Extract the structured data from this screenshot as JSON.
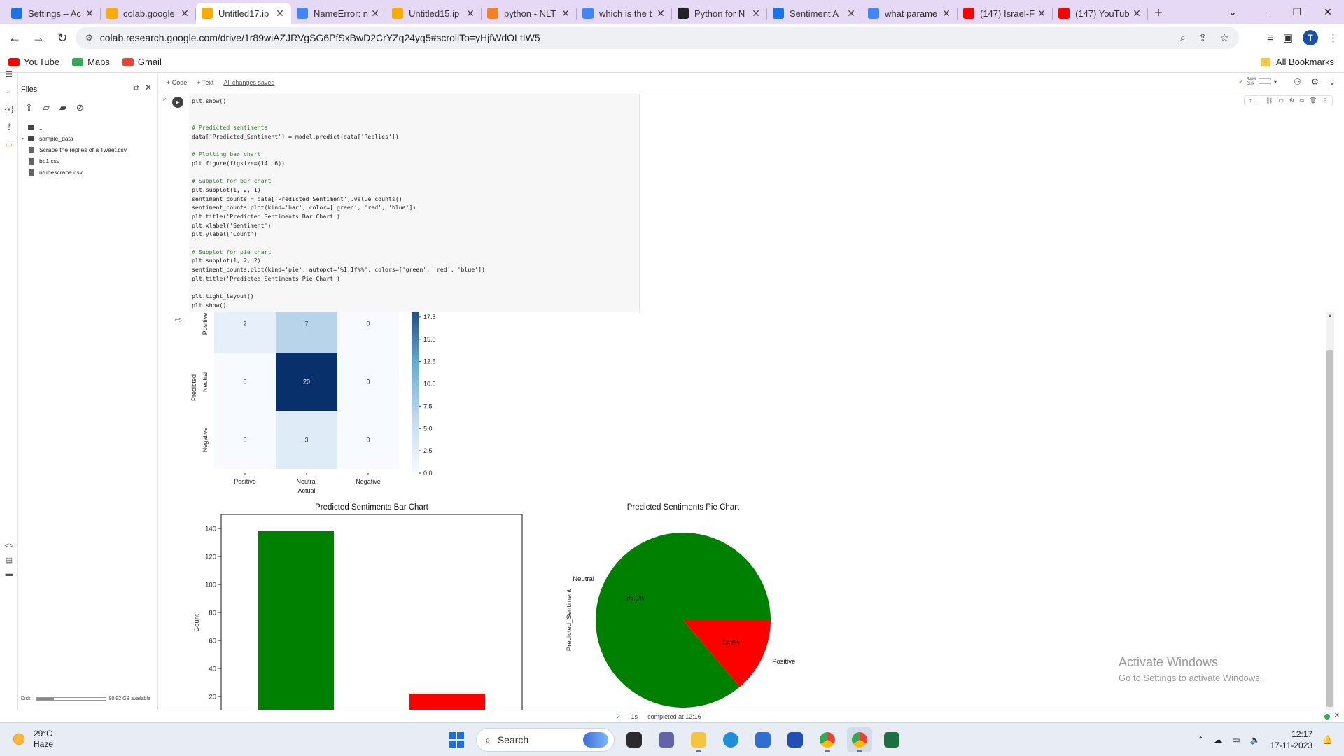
{
  "browser": {
    "tabs": [
      {
        "title": "Settings – Ac",
        "favicon": "gear-icon",
        "color": "#1a73e8"
      },
      {
        "title": "colab.google",
        "favicon": "colab-icon",
        "color": "#f9ab00"
      },
      {
        "title": "Untitled17.ip",
        "favicon": "colab-icon",
        "color": "#f9ab00",
        "active": true
      },
      {
        "title": "NameError: n",
        "favicon": "google-icon",
        "color": "#4285f4"
      },
      {
        "title": "Untitled15.ip",
        "favicon": "colab-icon",
        "color": "#f9ab00"
      },
      {
        "title": "python - NLT",
        "favicon": "stackoverflow-icon",
        "color": "#f48024"
      },
      {
        "title": "which is the t",
        "favicon": "google-icon",
        "color": "#4285f4"
      },
      {
        "title": "Python for N",
        "favicon": "site-icon",
        "color": "#222222"
      },
      {
        "title": "Sentiment A",
        "favicon": "shield-icon",
        "color": "#1a73e8"
      },
      {
        "title": "what parame",
        "favicon": "google-icon",
        "color": "#4285f4"
      },
      {
        "title": "(147) Israel-F",
        "favicon": "youtube-icon",
        "color": "#ff0000"
      },
      {
        "title": "(147) YouTub",
        "favicon": "youtube-icon",
        "color": "#ff0000"
      }
    ],
    "url": "colab.research.google.com/drive/1r89wiAZJRVgSG6PfSxBwD2CrYZq24yq5#scrollTo=yHjfWdOLtIW5",
    "avatar_letter": "T",
    "bookmarks": [
      {
        "label": "YouTube",
        "color": "#ff0000"
      },
      {
        "label": "Maps",
        "color": "#34a853"
      },
      {
        "label": "Gmail",
        "color": "#ea4335"
      }
    ],
    "all_bookmarks": "All Bookmarks"
  },
  "colab": {
    "files_title": "Files",
    "file_tree": [
      {
        "name": "..",
        "type": "dir",
        "expand": false
      },
      {
        "name": "sample_data",
        "type": "dir",
        "expand": true
      },
      {
        "name": "Scrape the replies of a Tweet.csv",
        "type": "file"
      },
      {
        "name": "bb1.csv",
        "type": "file"
      },
      {
        "name": "utubescrape.csv",
        "type": "file"
      }
    ],
    "disk_label": "Disk",
    "disk_fraction": 0.25,
    "disk_available": "80.92 GB available",
    "toolbar": {
      "code": "+ Code",
      "text": "+ Text",
      "saved": "All changes saved",
      "ram": "RAM",
      "disk": "Disk"
    },
    "code_lines": [
      {
        "t": "plt.show()",
        "k": "code"
      },
      {
        "t": "",
        "k": "code"
      },
      {
        "t": "",
        "k": "code"
      },
      {
        "t": "# Predicted sentiments",
        "k": "comment"
      },
      {
        "t": "data['Predicted_Sentiment'] = model.predict(data['Replies'])",
        "k": "code"
      },
      {
        "t": "",
        "k": "code"
      },
      {
        "t": "# Plotting bar chart",
        "k": "comment"
      },
      {
        "t": "plt.figure(figsize=(14, 6))",
        "k": "code"
      },
      {
        "t": "",
        "k": "code"
      },
      {
        "t": "# Subplot for bar chart",
        "k": "comment"
      },
      {
        "t": "plt.subplot(1, 2, 1)",
        "k": "code"
      },
      {
        "t": "sentiment_counts = data['Predicted_Sentiment'].value_counts()",
        "k": "code"
      },
      {
        "t": "sentiment_counts.plot(kind='bar', color=['green', 'red', 'blue'])",
        "k": "code"
      },
      {
        "t": "plt.title('Predicted Sentiments Bar Chart')",
        "k": "code"
      },
      {
        "t": "plt.xlabel('Sentiment')",
        "k": "code"
      },
      {
        "t": "plt.ylabel('Count')",
        "k": "code"
      },
      {
        "t": "",
        "k": "code"
      },
      {
        "t": "# Subplot for pie chart",
        "k": "comment"
      },
      {
        "t": "plt.subplot(1, 2, 2)",
        "k": "code"
      },
      {
        "t": "sentiment_counts.plot(kind='pie', autopct='%1.1f%%', colors=['green', 'red', 'blue'])",
        "k": "code"
      },
      {
        "t": "plt.title('Predicted Sentiments Pie Chart')",
        "k": "code"
      },
      {
        "t": "",
        "k": "code"
      },
      {
        "t": "plt.tight_layout()",
        "k": "code"
      },
      {
        "t": "plt.show()",
        "k": "code"
      }
    ],
    "status": {
      "check": "✓",
      "duration": "1s",
      "completed": "completed at 12:16"
    }
  },
  "chart_data": [
    {
      "type": "heatmap",
      "xlabel": "Actual",
      "ylabel": "Predicted",
      "x_labels": [
        "Positive",
        "Neutral",
        "Negative"
      ],
      "y_labels": [
        "Positive",
        "Neutral",
        "Negative"
      ],
      "values": [
        [
          2,
          7,
          0
        ],
        [
          0,
          20,
          0
        ],
        [
          0,
          3,
          0
        ]
      ],
      "colorbar_ticks": [
        "17.5",
        "15.0",
        "12.5",
        "10.0",
        "7.5",
        "5.0",
        "2.5",
        "0.0"
      ],
      "colorbar_range": [
        0,
        20
      ]
    },
    {
      "type": "bar",
      "title": "Predicted Sentiments Bar Chart",
      "ylabel": "Count",
      "values": [
        138,
        22
      ],
      "colors": [
        "#008000",
        "#ff0000"
      ],
      "ylim": [
        0,
        150
      ],
      "yticks": [
        "140",
        "120",
        "100",
        "80",
        "60",
        "40",
        "20"
      ]
    },
    {
      "type": "pie",
      "title": "Predicted Sentiments Pie Chart",
      "ylabel": "Predicted_Sentiment",
      "labels": [
        "Neutral",
        "Positive"
      ],
      "values": [
        86.3,
        13.8
      ],
      "pct_labels": [
        "86.3%",
        "13.8%"
      ],
      "colors": [
        "#008000",
        "#ff0000"
      ]
    }
  ],
  "watermark": {
    "line1": "Activate Windows",
    "line2": "Go to Settings to activate Windows."
  },
  "taskbar": {
    "temp": "29°C",
    "weather": "Haze",
    "search": "Search",
    "time": "12:17",
    "date": "17-11-2023"
  }
}
